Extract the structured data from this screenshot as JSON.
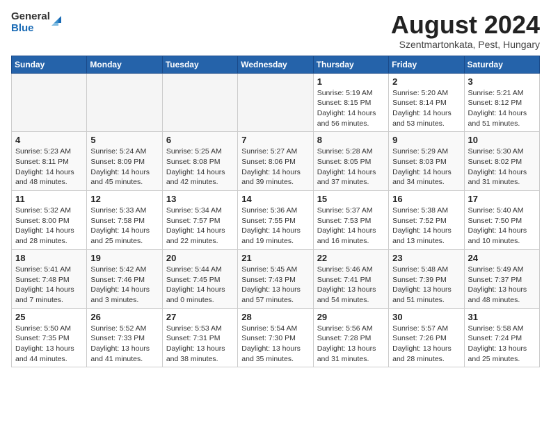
{
  "header": {
    "logo_line1": "General",
    "logo_line2": "Blue",
    "month_title": "August 2024",
    "subtitle": "Szentmartonkata, Pest, Hungary"
  },
  "weekdays": [
    "Sunday",
    "Monday",
    "Tuesday",
    "Wednesday",
    "Thursday",
    "Friday",
    "Saturday"
  ],
  "weeks": [
    [
      {
        "day": "",
        "empty": true
      },
      {
        "day": "",
        "empty": true
      },
      {
        "day": "",
        "empty": true
      },
      {
        "day": "",
        "empty": true
      },
      {
        "day": "1",
        "sunrise": "5:19 AM",
        "sunset": "8:15 PM",
        "daylight": "14 hours and 56 minutes."
      },
      {
        "day": "2",
        "sunrise": "5:20 AM",
        "sunset": "8:14 PM",
        "daylight": "14 hours and 53 minutes."
      },
      {
        "day": "3",
        "sunrise": "5:21 AM",
        "sunset": "8:12 PM",
        "daylight": "14 hours and 51 minutes."
      }
    ],
    [
      {
        "day": "4",
        "sunrise": "5:23 AM",
        "sunset": "8:11 PM",
        "daylight": "14 hours and 48 minutes."
      },
      {
        "day": "5",
        "sunrise": "5:24 AM",
        "sunset": "8:09 PM",
        "daylight": "14 hours and 45 minutes."
      },
      {
        "day": "6",
        "sunrise": "5:25 AM",
        "sunset": "8:08 PM",
        "daylight": "14 hours and 42 minutes."
      },
      {
        "day": "7",
        "sunrise": "5:27 AM",
        "sunset": "8:06 PM",
        "daylight": "14 hours and 39 minutes."
      },
      {
        "day": "8",
        "sunrise": "5:28 AM",
        "sunset": "8:05 PM",
        "daylight": "14 hours and 37 minutes."
      },
      {
        "day": "9",
        "sunrise": "5:29 AM",
        "sunset": "8:03 PM",
        "daylight": "14 hours and 34 minutes."
      },
      {
        "day": "10",
        "sunrise": "5:30 AM",
        "sunset": "8:02 PM",
        "daylight": "14 hours and 31 minutes."
      }
    ],
    [
      {
        "day": "11",
        "sunrise": "5:32 AM",
        "sunset": "8:00 PM",
        "daylight": "14 hours and 28 minutes."
      },
      {
        "day": "12",
        "sunrise": "5:33 AM",
        "sunset": "7:58 PM",
        "daylight": "14 hours and 25 minutes."
      },
      {
        "day": "13",
        "sunrise": "5:34 AM",
        "sunset": "7:57 PM",
        "daylight": "14 hours and 22 minutes."
      },
      {
        "day": "14",
        "sunrise": "5:36 AM",
        "sunset": "7:55 PM",
        "daylight": "14 hours and 19 minutes."
      },
      {
        "day": "15",
        "sunrise": "5:37 AM",
        "sunset": "7:53 PM",
        "daylight": "14 hours and 16 minutes."
      },
      {
        "day": "16",
        "sunrise": "5:38 AM",
        "sunset": "7:52 PM",
        "daylight": "14 hours and 13 minutes."
      },
      {
        "day": "17",
        "sunrise": "5:40 AM",
        "sunset": "7:50 PM",
        "daylight": "14 hours and 10 minutes."
      }
    ],
    [
      {
        "day": "18",
        "sunrise": "5:41 AM",
        "sunset": "7:48 PM",
        "daylight": "14 hours and 7 minutes."
      },
      {
        "day": "19",
        "sunrise": "5:42 AM",
        "sunset": "7:46 PM",
        "daylight": "14 hours and 3 minutes."
      },
      {
        "day": "20",
        "sunrise": "5:44 AM",
        "sunset": "7:45 PM",
        "daylight": "14 hours and 0 minutes."
      },
      {
        "day": "21",
        "sunrise": "5:45 AM",
        "sunset": "7:43 PM",
        "daylight": "13 hours and 57 minutes."
      },
      {
        "day": "22",
        "sunrise": "5:46 AM",
        "sunset": "7:41 PM",
        "daylight": "13 hours and 54 minutes."
      },
      {
        "day": "23",
        "sunrise": "5:48 AM",
        "sunset": "7:39 PM",
        "daylight": "13 hours and 51 minutes."
      },
      {
        "day": "24",
        "sunrise": "5:49 AM",
        "sunset": "7:37 PM",
        "daylight": "13 hours and 48 minutes."
      }
    ],
    [
      {
        "day": "25",
        "sunrise": "5:50 AM",
        "sunset": "7:35 PM",
        "daylight": "13 hours and 44 minutes."
      },
      {
        "day": "26",
        "sunrise": "5:52 AM",
        "sunset": "7:33 PM",
        "daylight": "13 hours and 41 minutes."
      },
      {
        "day": "27",
        "sunrise": "5:53 AM",
        "sunset": "7:31 PM",
        "daylight": "13 hours and 38 minutes."
      },
      {
        "day": "28",
        "sunrise": "5:54 AM",
        "sunset": "7:30 PM",
        "daylight": "13 hours and 35 minutes."
      },
      {
        "day": "29",
        "sunrise": "5:56 AM",
        "sunset": "7:28 PM",
        "daylight": "13 hours and 31 minutes."
      },
      {
        "day": "30",
        "sunrise": "5:57 AM",
        "sunset": "7:26 PM",
        "daylight": "13 hours and 28 minutes."
      },
      {
        "day": "31",
        "sunrise": "5:58 AM",
        "sunset": "7:24 PM",
        "daylight": "13 hours and 25 minutes."
      }
    ]
  ],
  "labels": {
    "sunrise": "Sunrise:",
    "sunset": "Sunset:",
    "daylight": "Daylight:"
  }
}
